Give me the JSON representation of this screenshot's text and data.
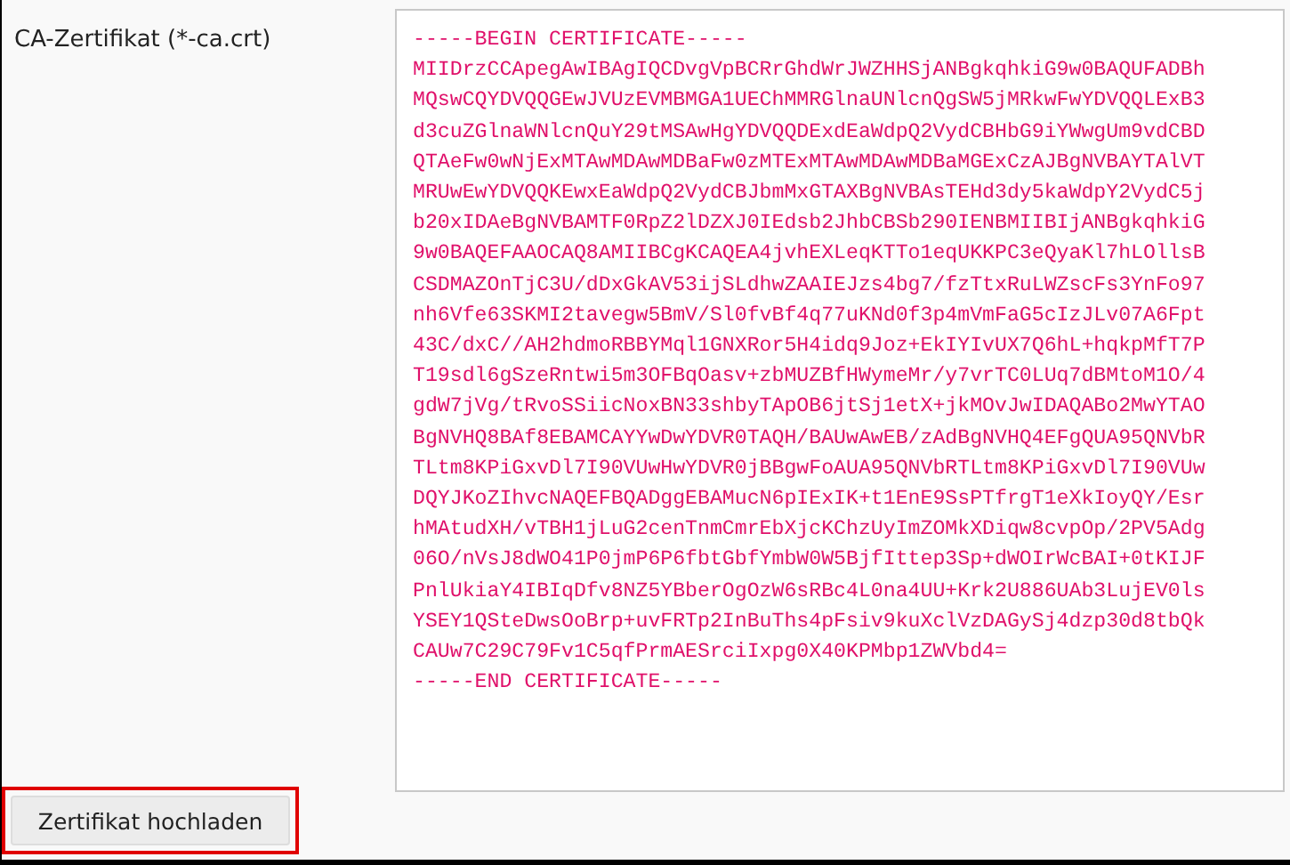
{
  "field": {
    "label": "CA-Zertifikat (*-ca.crt)",
    "lines": [
      "-----BEGIN CERTIFICATE-----",
      "MIIDrzCCApegAwIBAgIQCDvgVpBCRrGhdWrJWZHHSjANBgkqhkiG9w0BAQUFADBh",
      "MQswCQYDVQQGEwJVUzEVMBMGA1UEChMMRGlnaUNlcnQgSW5jMRkwFwYDVQQLExB3",
      "d3cuZGlnaWNlcnQuY29tMSAwHgYDVQQDExdEaWdpQ2VydCBHbG9iYWwgUm9vdCBD",
      "QTAeFw0wNjExMTAwMDAwMDBaFw0zMTExMTAwMDAwMDBaMGExCzAJBgNVBAYTAlVT",
      "MRUwEwYDVQQKEwxEaWdpQ2VydCBJbmMxGTAXBgNVBAsTEHd3dy5kaWdpY2VydC5j",
      "b20xIDAeBgNVBAMTF0RpZ2lDZXJ0IEdsb2JhbCBSb290IENBMIIBIjANBgkqhkiG",
      "9w0BAQEFAAOCAQ8AMIIBCgKCAQEA4jvhEXLeqKTTo1eqUKKPC3eQyaKl7hLOllsB",
      "CSDMAZOnTjC3U/dDxGkAV53ijSLdhwZAAIEJzs4bg7/fzTtxRuLWZscFs3YnFo97",
      "nh6Vfe63SKMI2tavegw5BmV/Sl0fvBf4q77uKNd0f3p4mVmFaG5cIzJLv07A6Fpt",
      "43C/dxC//AH2hdmoRBBYMql1GNXRor5H4idq9Joz+EkIYIvUX7Q6hL+hqkpMfT7P",
      "T19sdl6gSzeRntwi5m3OFBqOasv+zbMUZBfHWymeMr/y7vrTC0LUq7dBMtoM1O/4",
      "gdW7jVg/tRvoSSiicNoxBN33shbyTApOB6jtSj1etX+jkMOvJwIDAQABo2MwYTAO",
      "BgNVHQ8BAf8EBAMCAYYwDwYDVR0TAQH/BAUwAwEB/zAdBgNVHQ4EFgQUA95QNVbR",
      "TLtm8KPiGxvDl7I90VUwHwYDVR0jBBgwFoAUA95QNVbRTLtm8KPiGxvDl7I90VUw",
      "DQYJKoZIhvcNAQEFBQADggEBAMucN6pIExIK+t1EnE9SsPTfrgT1eXkIoyQY/Esr",
      "hMAtudXH/vTBH1jLuG2cenTnmCmrEbXjcKChzUyImZOMkXDiqw8cvpOp/2PV5Adg",
      "06O/nVsJ8dWO41P0jmP6P6fbtGbfYmbW0W5BjfIttep3Sp+dWOIrWcBAI+0tKIJF",
      "PnlUkiaY4IBIqDfv8NZ5YBberOgOzW6sRBc4L0na4UU+Krk2U886UAb3LujEV0ls",
      "YSEY1QSteDwsOoBrp+uvFRTp2InBuThs4pFsiv9kuXclVzDAGySj4dzp30d8tbQk",
      "CAUw7C29C79Fv1C5qfPrmAESrciIxpg0X40KPMbp1ZWVbd4=",
      "-----END CERTIFICATE-----"
    ]
  },
  "upload_button": {
    "label": "Zertifikat hochladen",
    "highlighted": true
  }
}
